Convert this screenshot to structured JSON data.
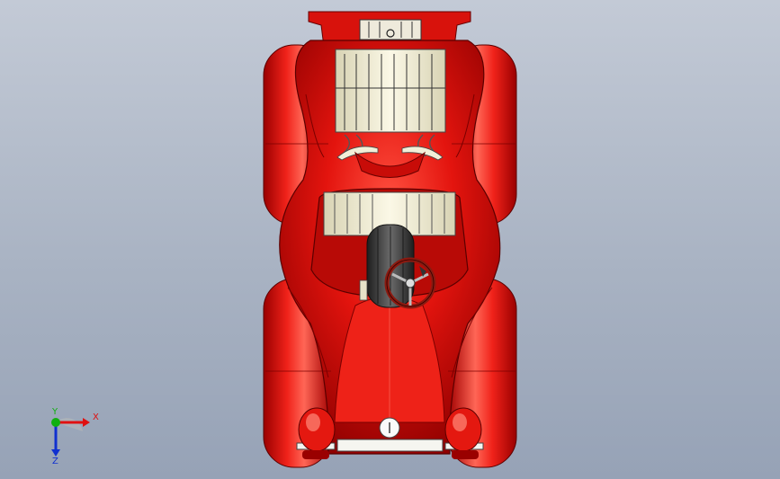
{
  "viewport": {
    "background_top": "#c3cad6",
    "background_bottom": "#96a2b6"
  },
  "model": {
    "body_color": "#e0100c",
    "body_dark": "#8a0000",
    "body_highlight": "#ff6a5a",
    "engine_color": "#f2efd8",
    "tire_color": "#3a3a3a",
    "steering_wheel_color": "#8b1a10"
  },
  "triad": {
    "x_label": "X",
    "y_label": "Y",
    "z_label": "Z",
    "x_color": "#e01010",
    "y_color": "#10b010",
    "z_color": "#1030d0"
  }
}
